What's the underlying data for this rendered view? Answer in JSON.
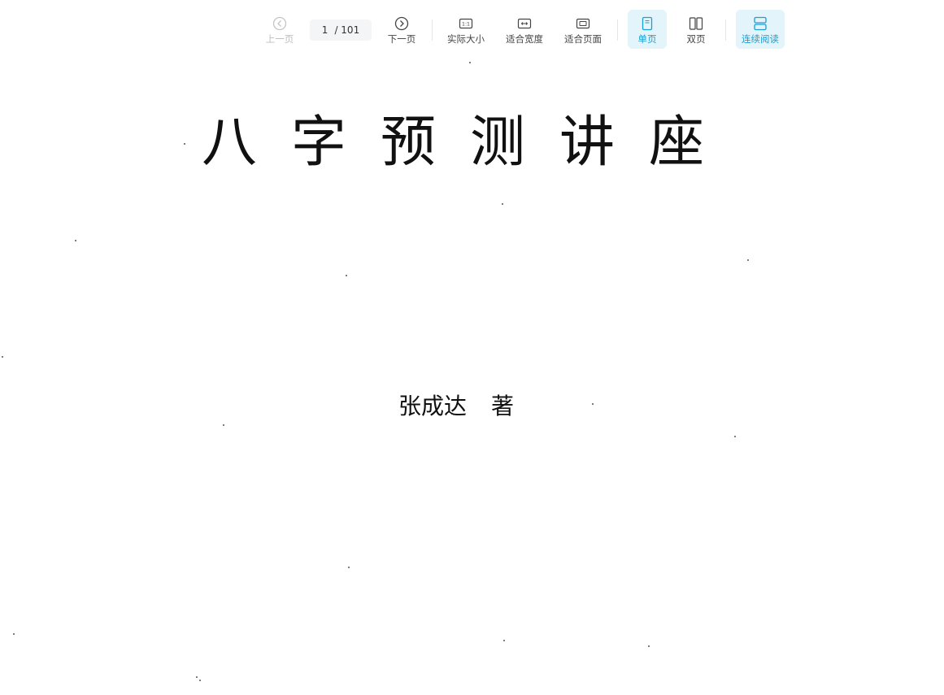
{
  "toolbar": {
    "prev_label": "上一页",
    "page_current": "1",
    "page_total": "/ 101",
    "next_label": "下一页",
    "actual_size_label": "实际大小",
    "actual_size_icon_text": "1:1",
    "fit_width_label": "适合宽度",
    "fit_page_label": "适合页面",
    "single_page_label": "单页",
    "double_page_label": "双页",
    "continuous_label": "连续阅读",
    "accent_color": "#1a9fd6",
    "active_bg": "#e3f4fb"
  },
  "document": {
    "title": "八字预测讲座",
    "author_name": "张成达",
    "author_role": "著"
  }
}
